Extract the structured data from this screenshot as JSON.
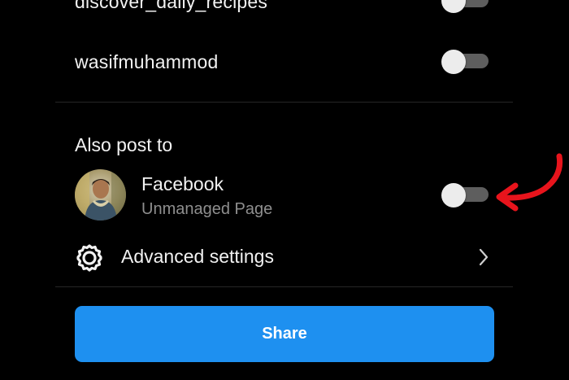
{
  "accounts": [
    {
      "name": "discover_daily_recipes",
      "enabled": false
    },
    {
      "name": "wasifmuhammod",
      "enabled": false
    }
  ],
  "also_post": {
    "title": "Also post to",
    "facebook": {
      "name": "Facebook",
      "subtitle": "Unmanaged Page",
      "enabled": false
    }
  },
  "advanced": {
    "label": "Advanced settings",
    "icon": "gear-icon"
  },
  "share": {
    "label": "Share"
  },
  "colors": {
    "background": "#000000",
    "accent": "#1e90f0",
    "annotation_arrow": "#e8141c",
    "toggle_track_off": "#5e5e5e",
    "toggle_knob": "#ececec"
  }
}
